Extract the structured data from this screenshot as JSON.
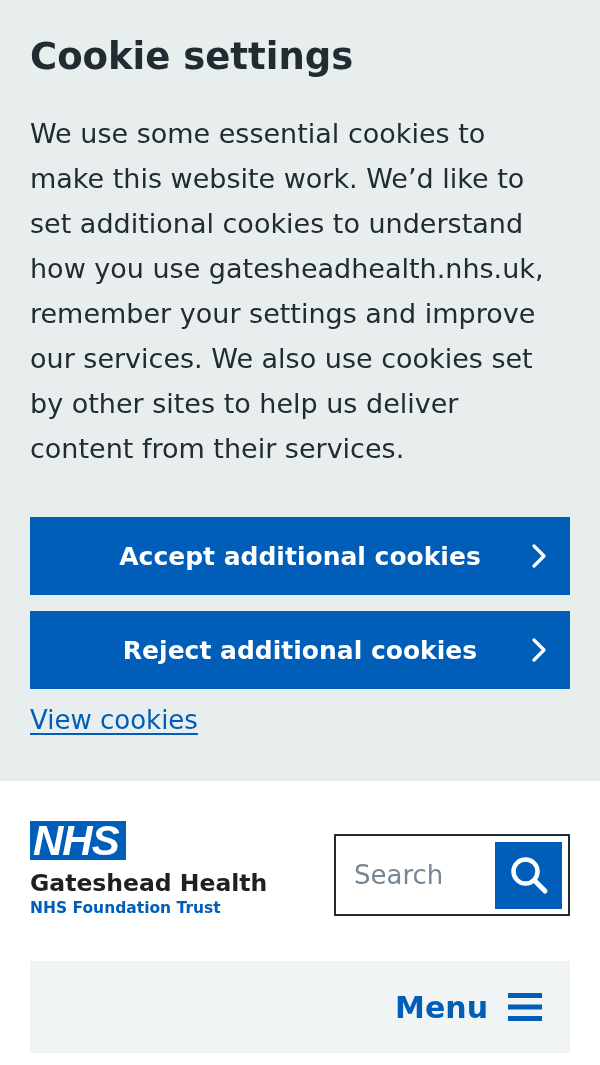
{
  "cookie_banner": {
    "title": "Cookie settings",
    "body": "We use some essential cookies to make this website work. We’d like to set additional cookies to understand how you use gatesheadhealth.nhs.uk, remember your settings and improve our services. We also use cookies set by other sites to help us deliver content from their services.",
    "buttons": [
      "Accept additional cookies",
      "Reject additional cookies"
    ],
    "link": "View cookies"
  },
  "header": {
    "logo": {
      "badge": "NHS",
      "name": "Gateshead Health",
      "subtitle": "NHS Foundation Trust"
    },
    "search": {
      "placeholder": "Search"
    },
    "menu": {
      "label": "Menu"
    }
  }
}
